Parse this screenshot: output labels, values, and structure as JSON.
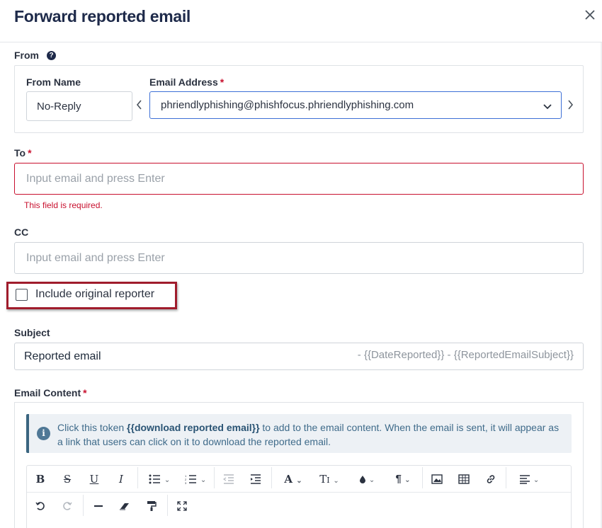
{
  "dialog": {
    "title": "Forward reported email"
  },
  "from": {
    "section_label": "From",
    "from_name_label": "From Name",
    "from_name_value": "No-Reply",
    "email_address_label": "Email Address",
    "email_address_value": "phriendlyphishing@phishfocus.phriendlyphishing.com"
  },
  "to": {
    "label": "To",
    "placeholder": "Input email and press Enter",
    "error": "This field is required."
  },
  "cc": {
    "label": "CC",
    "placeholder": "Input email and press Enter"
  },
  "include_original_reporter": {
    "label": "Include original reporter",
    "checked": false
  },
  "subject": {
    "label": "Subject",
    "value": "Reported email",
    "suffix": "- {{DateReported}} - {{ReportedEmailSubject}}"
  },
  "email_content": {
    "label": "Email Content",
    "info_prefix": "Click this token ",
    "info_token": "{{download reported email}}",
    "info_suffix": " to add to the email content. When the email is sent, it will appear as a link that users can click on it to download the reported email."
  },
  "required_marker": "*",
  "colors": {
    "accent": "#3d6fd6",
    "error": "#c8102e",
    "title": "#1e2a4a",
    "highlight": "#a01c2c"
  }
}
